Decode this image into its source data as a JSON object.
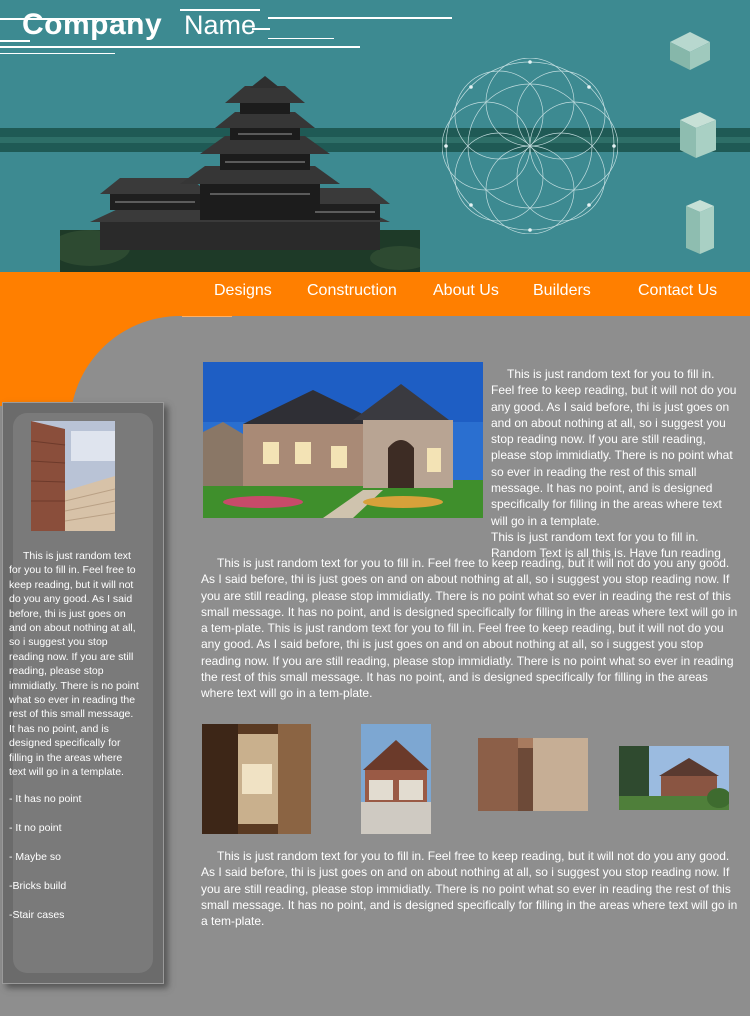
{
  "header": {
    "logo_company": "Company",
    "logo_name": "Name"
  },
  "nav": {
    "items": [
      "Designs",
      "Construction",
      "About Us",
      "Builders",
      "Contact Us"
    ]
  },
  "sidebar": {
    "paragraph": "This is just random text for you to fill in.  Feel free to keep reading, but it will not do you any good.  As I said before, thi is just goes on and on about nothing at all, so i suggest you stop reading now.  If you are still reading, please stop immidiatly.  There is no point what so ever in reading the rest of this small message.  It has no point, and is designed specifically for filling in the areas where text will go in a template.",
    "list": [
      "- It has no point",
      "- It no point",
      "- Maybe so",
      "-Bricks build",
      "-Stair cases"
    ]
  },
  "main": {
    "intro_1": "This is just random text for you to fill in.  Feel free to keep reading, but it will not do you any good.  As I said before, thi is just goes on and on about nothing at all, so i suggest you stop reading now.  If you are still reading, please stop immidiatly.  There is no point what so ever in reading the rest of this small message.  It has no point, and is designed specifically for filling in the areas where text will go in a template.",
    "intro_2": "This is just random text for you to fill in.",
    "intro_3": "Random Text is all this is.  Have fun reading",
    "body": "This is just random text for you to fill in.  Feel free to keep reading, but it will not do you any good.  As I said before, thi is just goes on and on about nothing at all, so i suggest you stop reading now.  If you are still reading, please stop immidiatly.  There is no point what so ever in reading the rest of this small message.  It has no point, and is designed specifically for filling in the areas where text will go in a tem-plate.     This is just random text for you to fill in.  Feel free to keep reading, but it will not do you any good.  As I said before, thi is just goes on and on about nothing at all, so i suggest you stop reading now.  If you are still reading, please stop immidiatly.  There is no point what so ever in reading the rest of this small message.  It has no point, and is designed specifically for filling in the areas where text will go in a tem-plate.",
    "footer": "This is just random text for you to fill in.  Feel free to keep reading, but it will not do you any good.  As I said before, thi is just goes on and on about nothing at all, so i suggest you stop reading now.  If you are still reading, please stop immidiatly.  There is no point what so ever in reading the rest of this small message.  It has no point, and is designed specifically for filling in the areas where text will go in a tem-plate."
  },
  "colors": {
    "header_teal": "#3d8a91",
    "nav_orange": "#ff7f00",
    "page_gray": "#8e8e8e",
    "sidebar_gray": "#6b6b6b"
  }
}
